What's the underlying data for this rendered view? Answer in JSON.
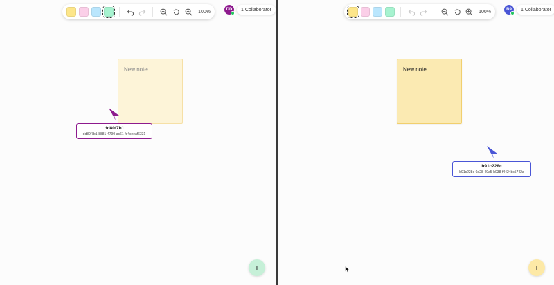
{
  "left": {
    "avatar": "DD",
    "avatar_color": "#8e1a8e",
    "collaborators": "1 Collaborator",
    "zoom": "100%",
    "selected_swatch": "green",
    "note_text": "New note",
    "cursor": {
      "short": "dd80f7b1",
      "long": "dd80f7b1-8881-4790-ac61-fc4ceeaf6331",
      "color": "#8e1a8e"
    },
    "fab_label": "+",
    "fab_color": "#c6f0d8"
  },
  "right": {
    "avatar": "B9",
    "avatar_color": "#4a56d6",
    "collaborators": "1 Collaborator",
    "zoom": "100%",
    "selected_swatch": "yellow",
    "note_text": "New note",
    "cursor": {
      "short": "b91c228c",
      "long": "b91c228c-0a28-49a5-b038-f4424bc5742a",
      "color": "#4a56d6"
    },
    "fab_label": "+",
    "fab_color": "#fde9a6"
  },
  "swatches": [
    {
      "name": "yellow",
      "color": "#fde68a"
    },
    {
      "name": "pink",
      "color": "#fbcfe8"
    },
    {
      "name": "blue",
      "color": "#bae6fd"
    },
    {
      "name": "green",
      "color": "#a7f3d0"
    }
  ],
  "icons": [
    "undo-icon",
    "redo-icon",
    "zoom-out-icon",
    "reset-zoom-icon",
    "zoom-in-icon"
  ]
}
